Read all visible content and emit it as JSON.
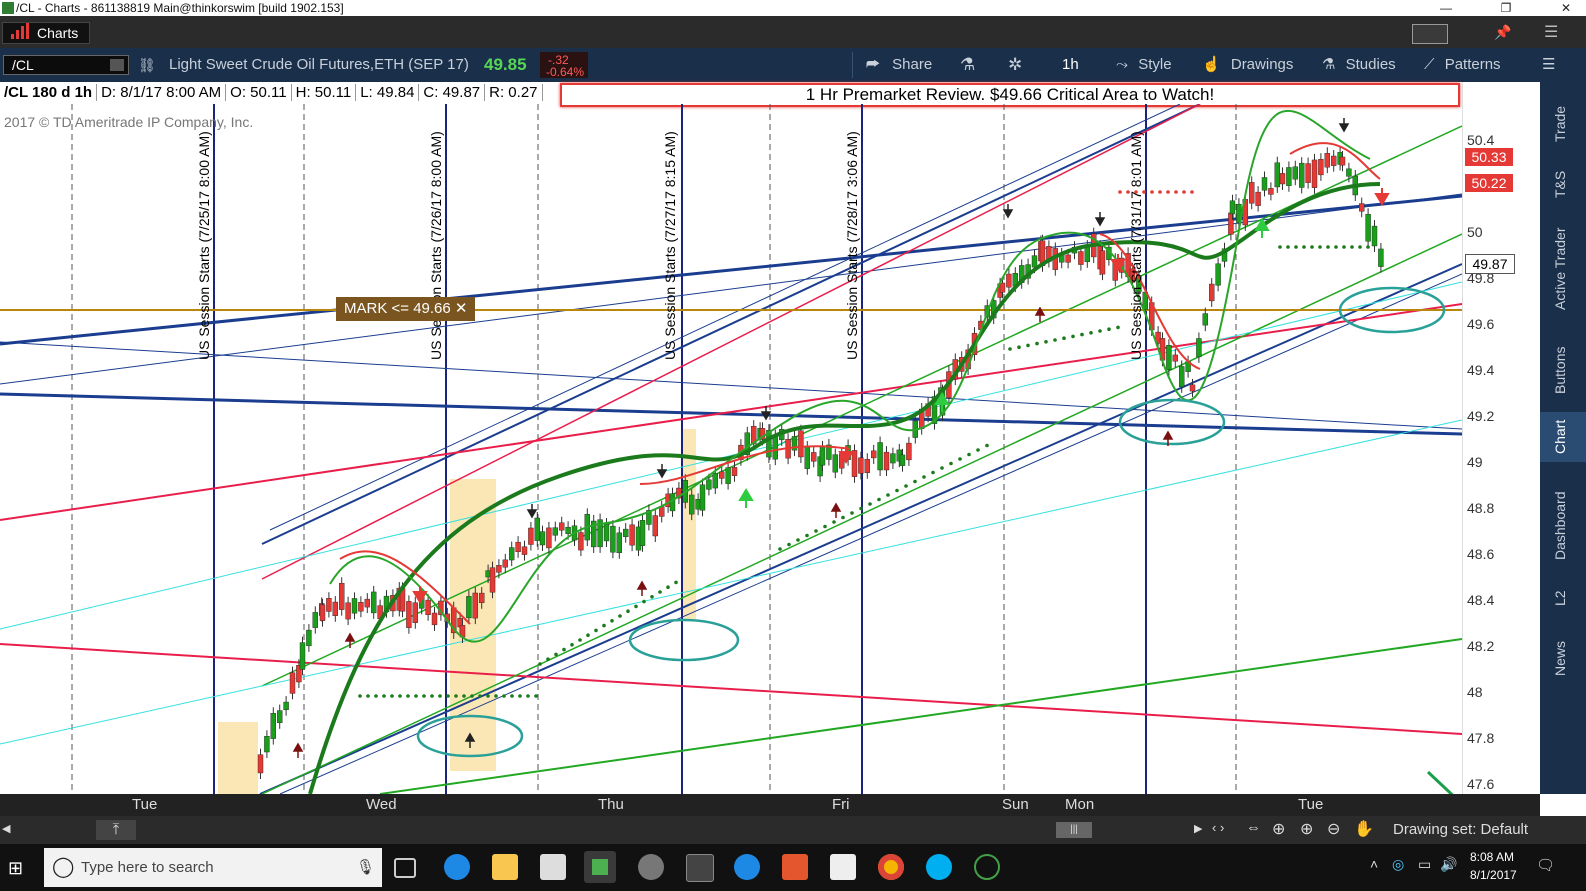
{
  "window": {
    "title": "/CL - Charts - 861138819 Main@thinkorswim [build 1902.153]",
    "minimize": "—",
    "restore": "❐",
    "close": "✕"
  },
  "top_row": {
    "charts_label": "Charts"
  },
  "toolbar": {
    "symbol": "/CL",
    "description": "Light Sweet Crude Oil Futures,ETH (SEP 17)",
    "last_price": "49.85",
    "change": "-.32",
    "change_pct": "-0.64%",
    "share": "Share",
    "timeframe": "1h",
    "style": "Style",
    "drawings": "Drawings",
    "studies": "Studies",
    "patterns": "Patterns"
  },
  "info_bar": {
    "title": "/CL 180 d 1h",
    "date": "D: 8/1/17 8:00 AM",
    "open": "O: 50.11",
    "high": "H: 50.11",
    "low": "L: 49.84",
    "close": "C: 49.87",
    "range": "R: 0.27"
  },
  "headline": "1 Hr Premarket Review.  $49.66 Critical Area to Watch!",
  "copyright": "2017 © TD Ameritrade IP Company, Inc.",
  "mark_label": "MARK <= 49.66  ✕",
  "session_labels": [
    "US Session Starts (7/25/17 8:00 AM)",
    "US Session Starts (7/26/17 8:00 AM)",
    "US Session Starts (7/27/17 8:15 AM)",
    "US Session Starts (7/28/17 3:06 AM)",
    "US Session Starts (7/31/17 8:01 AM)"
  ],
  "price_axis": {
    "labels": [
      "50.4",
      "50",
      "49.8",
      "49.6",
      "49.4",
      "49.2",
      "49",
      "48.8",
      "48.6",
      "48.4",
      "48.2",
      "48",
      "47.8",
      "47.6"
    ],
    "bubble_high": "50.33",
    "bubble_mid": "50.22",
    "bubble_last": "49.87"
  },
  "side_tabs": [
    "Trade",
    "T&S",
    "Active Trader",
    "Buttons",
    "Chart",
    "Dashboard",
    "L2",
    "News"
  ],
  "time_axis": [
    "Tue",
    "Wed",
    "Thu",
    "Fri",
    "Sun",
    "Mon",
    "Tue"
  ],
  "bottom_bar": {
    "drawing_set": "Drawing set: Default"
  },
  "taskbar": {
    "search_placeholder": "Type here to search",
    "time": "8:08 AM",
    "date": "8/1/2017"
  },
  "colors": {
    "toolbar_bg": "#1a2f4a",
    "up_candle": "#1b9e1b",
    "down_candle": "#e53935",
    "price_green": "#56d656",
    "price_red": "#ff5a5a",
    "mark_bg": "#7a5520",
    "annotation_teal": "#2aa198"
  }
}
